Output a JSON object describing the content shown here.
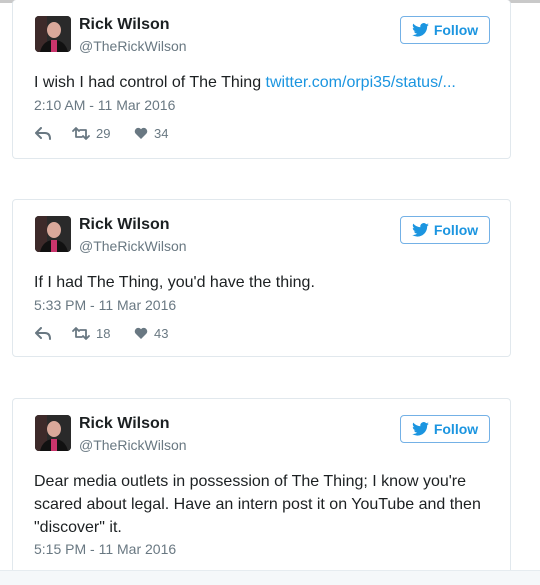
{
  "tweets": [
    {
      "name": "Rick Wilson",
      "handle": "@TheRickWilson",
      "follow_label": "Follow",
      "text": "I wish I had control of The Thing ",
      "link": "twitter.com/orpi35/status/...",
      "date": "2:10 AM - 11 Mar 2016",
      "retweets": "29",
      "likes": "34"
    },
    {
      "name": "Rick Wilson",
      "handle": "@TheRickWilson",
      "follow_label": "Follow",
      "text": "If I had The Thing, you'd have the thing.",
      "date": "5:33 PM - 11 Mar 2016",
      "retweets": "18",
      "likes": "43"
    },
    {
      "name": "Rick Wilson",
      "handle": "@TheRickWilson",
      "follow_label": "Follow",
      "text_lines": [
        "Dear media outlets in possession of The Thing; I know you're",
        "scared about legal. Have an intern post it on YouTube and then",
        "\"discover\" it."
      ],
      "date": "5:15 PM - 11 Mar 2016"
    }
  ],
  "icons": {
    "reply": "reply-icon",
    "retweet": "retweet-icon",
    "like": "heart-icon",
    "twitter": "twitter-bird-icon"
  },
  "colors": {
    "link": "#1b95e0",
    "muted": "#697882",
    "border": "#e1e8ed"
  }
}
